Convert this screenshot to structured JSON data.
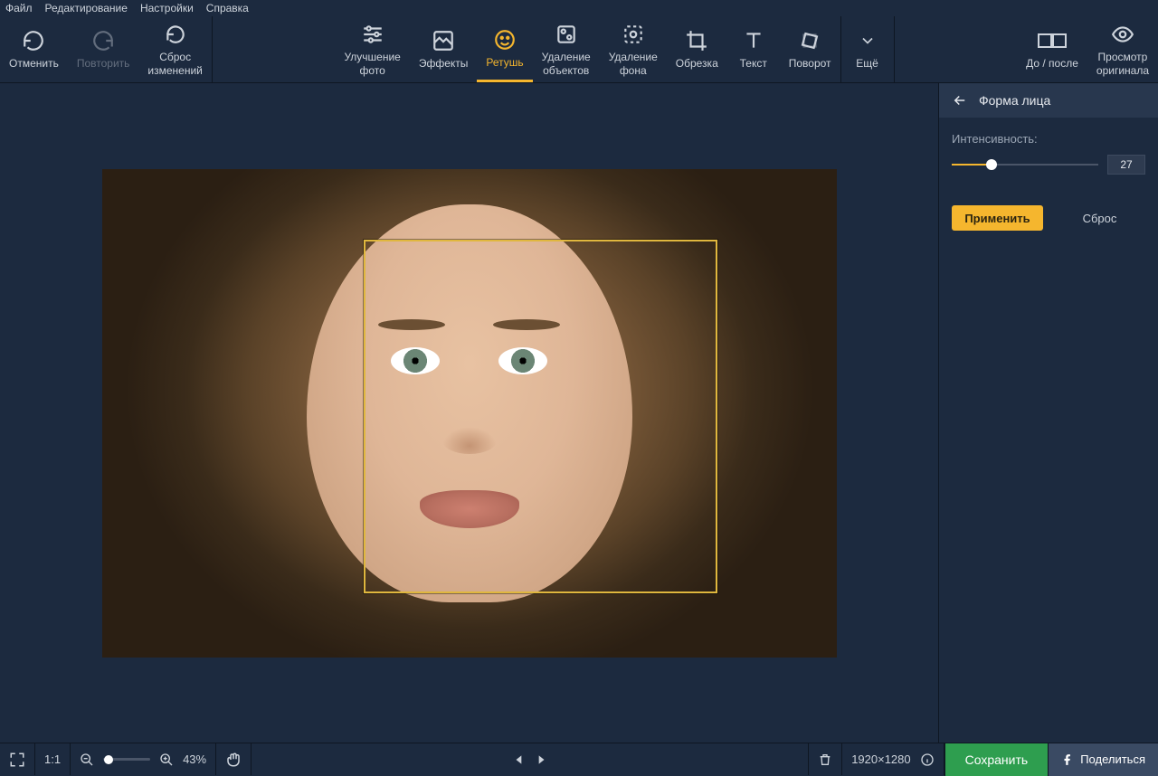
{
  "menubar": {
    "items": [
      "Файл",
      "Редактирование",
      "Настройки",
      "Справка"
    ]
  },
  "toolbar": {
    "undo": "Отменить",
    "redo": "Повторить",
    "reset": "Сброс\nизменений",
    "enhance": "Улучшение\nфото",
    "effects": "Эффекты",
    "retouch": "Ретушь",
    "removeObj": "Удаление\nобъектов",
    "removeBg": "Удаление\nфона",
    "crop": "Обрезка",
    "text": "Текст",
    "rotate": "Поворот",
    "more": "Ещё",
    "beforeAfter": "До / после",
    "viewOriginal": "Просмотр\nоригинала"
  },
  "sidebar": {
    "title": "Форма лица",
    "intensityLabel": "Интенсивность:",
    "intensityValue": "27",
    "apply": "Применить",
    "reset": "Сброс"
  },
  "statusbar": {
    "oneToOne": "1:1",
    "zoom": "43%",
    "dimensions": "1920×1280",
    "save": "Сохранить",
    "share": "Поделиться"
  }
}
